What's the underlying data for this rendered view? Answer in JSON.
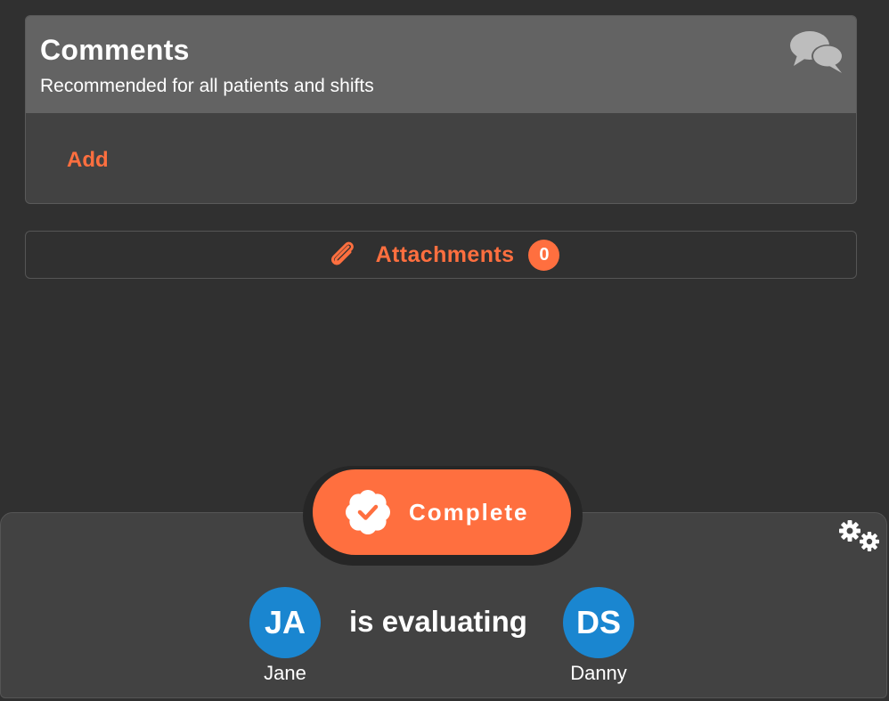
{
  "comments": {
    "title": "Comments",
    "subtitle": "Recommended for all patients and shifts",
    "icon": "comments-icon",
    "add_label": "Add"
  },
  "attachments": {
    "label": "Attachments",
    "count": "0",
    "icon": "paperclip-icon"
  },
  "action": {
    "complete_label": "Complete",
    "icon": "badge-check-icon",
    "settings_icon": "gears-icon"
  },
  "evaluation": {
    "patient": {
      "initials": "JA",
      "name": "Jane"
    },
    "status_text": "is evaluating",
    "evaluator": {
      "initials": "DS",
      "name": "Danny"
    }
  },
  "colors": {
    "accent": "#ff6f3f",
    "avatar": "#1a86d0",
    "background": "#303030",
    "panel": "#424242",
    "header": "#636363"
  }
}
